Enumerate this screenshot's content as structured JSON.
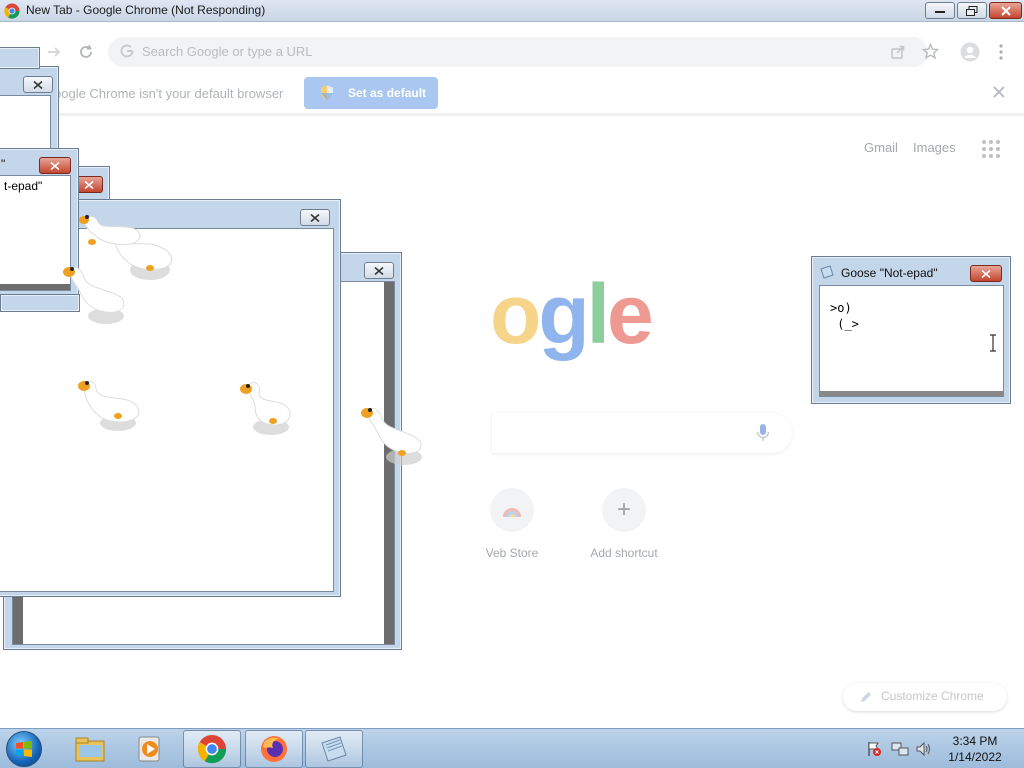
{
  "window": {
    "title": "New Tab - Google Chrome (Not Responding)"
  },
  "toolbar": {
    "omnibox_placeholder": "Search Google or type a URL"
  },
  "infobar": {
    "message": "oogle Chrome isn't your default browser",
    "set_default_label": "Set as default"
  },
  "ntp": {
    "links": [
      "Gmail",
      "Images"
    ],
    "logo_letters": [
      {
        "ch": "o",
        "color": "#f6d48a"
      },
      {
        "ch": "g",
        "color": "#8fb4ee"
      },
      {
        "ch": "l",
        "color": "#8dcf9c"
      },
      {
        "ch": "e",
        "color": "#ee9a93"
      }
    ],
    "shortcuts": [
      {
        "label": "Veb Store"
      },
      {
        "label": "Add shortcut",
        "glyph": "+"
      }
    ],
    "customize_label": "Customize Chrome"
  },
  "goose_windows": [
    {
      "title": "Goose \"Not-epad\"",
      "text": ">o)\n (_>"
    },
    {
      "title": "\"",
      "subtitle": "t-epad\""
    }
  ],
  "taskbar": {
    "time": "3:34 PM",
    "date": "1/14/2022"
  },
  "icons": {
    "chrome": "chrome-icon",
    "explorer": "file-explorer-icon",
    "media": "media-player-icon",
    "firefox": "firefox-icon",
    "notepad": "notepad-icon"
  },
  "colors": {
    "close_red": "#c4452f",
    "infobar_button": "#a9c7f0",
    "window_frame": "#c4d6ea"
  }
}
